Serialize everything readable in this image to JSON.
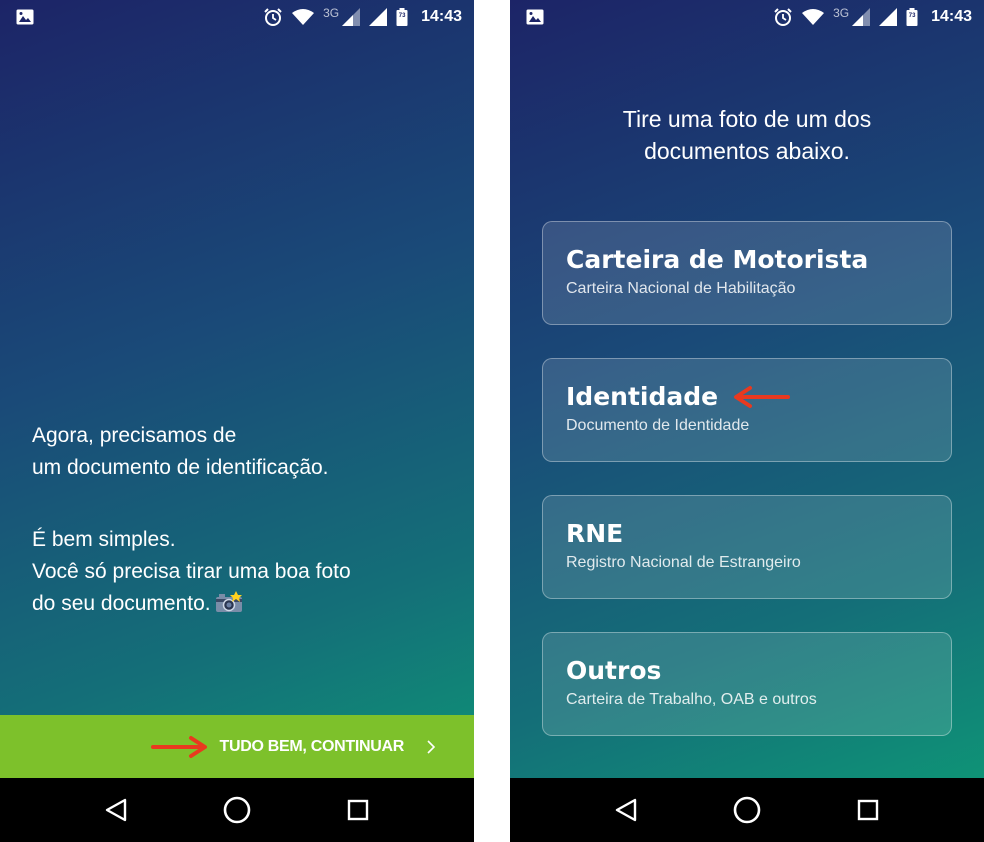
{
  "status_bar": {
    "network": "3G",
    "battery_level": "73",
    "time": "14:43"
  },
  "left_screen": {
    "intro_line1": "Agora, precisamos de",
    "intro_line2": "um documento de identificação.",
    "simple_line1": "É bem simples.",
    "simple_line2": "Você só precisa tirar uma boa foto",
    "simple_line3": "do seu documento.",
    "continue_label": "TUDO BEM, CONTINUAR",
    "continue_color": "#7dc12b"
  },
  "right_screen": {
    "prompt_line1": "Tire uma foto de um dos",
    "prompt_line2": "documentos abaixo.",
    "options": [
      {
        "title": "Carteira de Motorista",
        "subtitle": "Carteira Nacional de Habilitação"
      },
      {
        "title": "Identidade",
        "subtitle": "Documento de Identidade"
      },
      {
        "title": "RNE",
        "subtitle": "Registro Nacional de Estrangeiro"
      },
      {
        "title": "Outros",
        "subtitle": "Carteira de Trabalho, OAB e outros"
      }
    ]
  },
  "annotation_color": "#e8391f",
  "icons": [
    "gallery-icon",
    "alarm-icon",
    "wifi-icon",
    "signal-icon",
    "battery-icon",
    "camera-icon",
    "arrow-right-icon",
    "chevron-right-icon",
    "back-icon",
    "home-icon",
    "recents-icon"
  ]
}
